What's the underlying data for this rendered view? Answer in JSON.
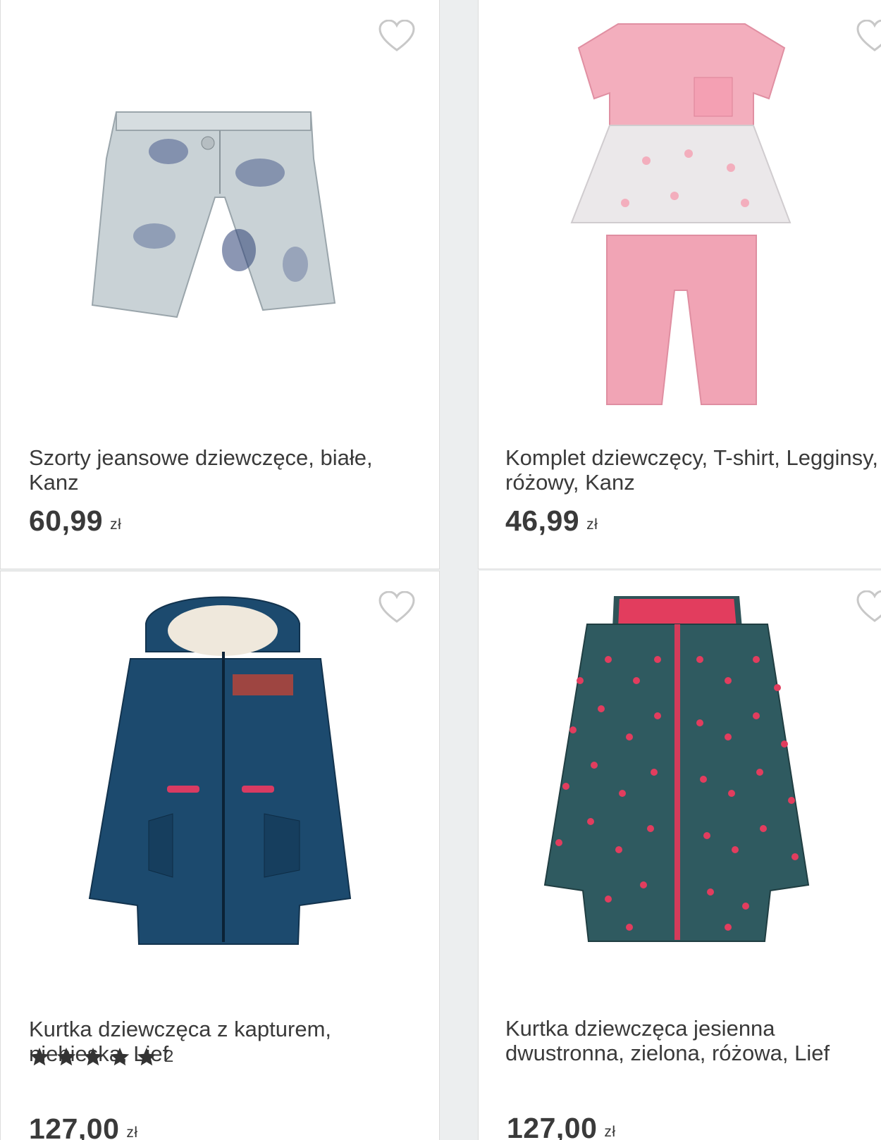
{
  "products": [
    {
      "title": "Szorty jeansowe dziewczęce, białe, Kanz",
      "price": "60,99",
      "currency": "zł",
      "image": "denim-shorts-image"
    },
    {
      "title": "Komplet dziewczęcy, T-shirt, Legginsy, różowy, Kanz",
      "price": "46,99",
      "currency": "zł",
      "image": "pink-outfit-image"
    },
    {
      "title": "Kurtka dziewczęca z kapturem, niebieska, Lief",
      "rating_stars": 5,
      "rating_count": "2",
      "price": "127,00",
      "currency": "zł",
      "image": "navy-parka-image"
    },
    {
      "title": "Kurtka dziewczęca jesienna dwustronna, zielona, różowa, Lief",
      "price": "127,00",
      "currency": "zł",
      "image": "teal-dotted-jacket-image"
    }
  ],
  "icons": {
    "favorite": "heart-outline-icon",
    "rating": "star-icon"
  },
  "colors": {
    "text": "#3a3a3a",
    "heart": "#c8c8c8",
    "star": "#333333"
  }
}
